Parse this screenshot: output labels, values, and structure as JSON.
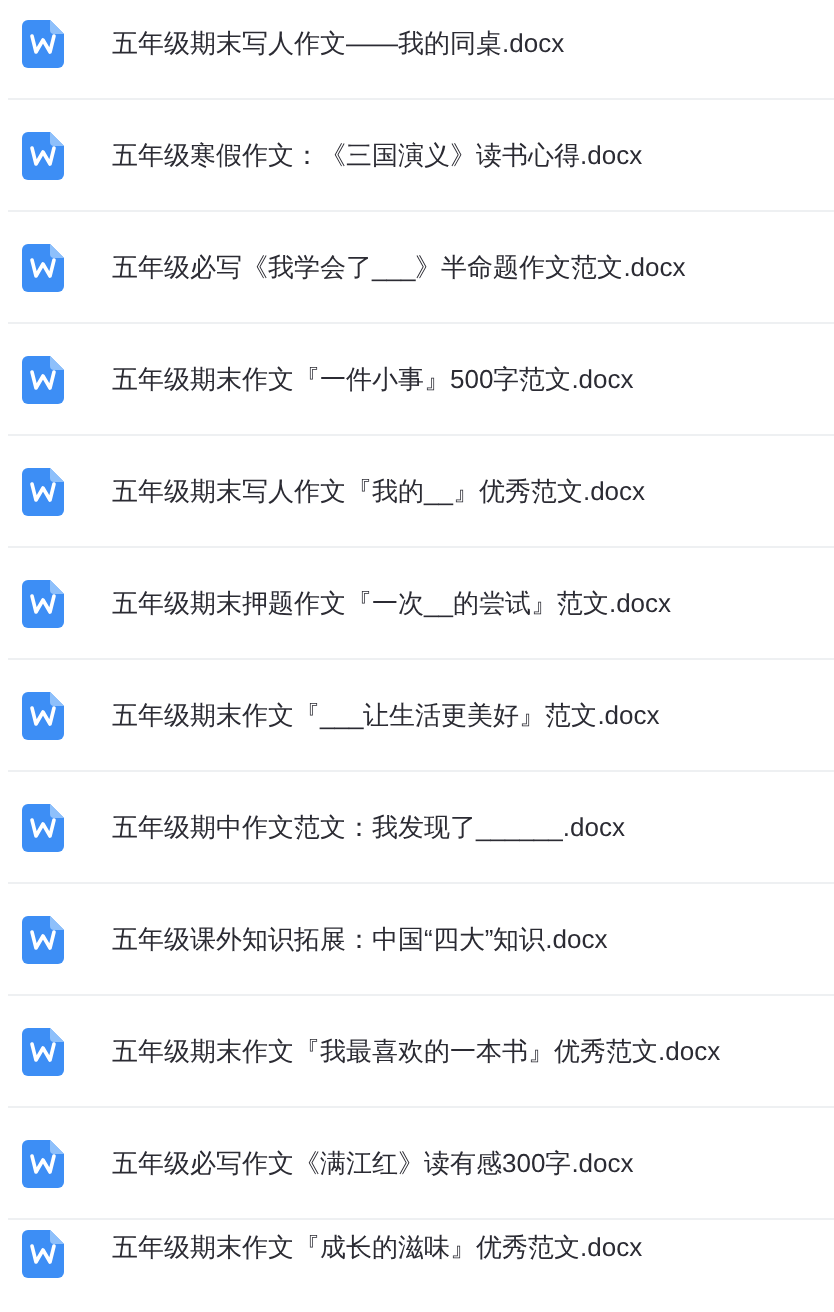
{
  "files": [
    {
      "kind": "word",
      "name": "五年级期末写人作文——我的同桌.docx"
    },
    {
      "kind": "word",
      "name": "五年级寒假作文：《三国演义》读书心得.docx"
    },
    {
      "kind": "word",
      "name": "五年级必写《我学会了___》半命题作文范文.docx"
    },
    {
      "kind": "word",
      "name": "五年级期末作文『一件小事』500字范文.docx"
    },
    {
      "kind": "word",
      "name": "五年级期末写人作文『我的__』优秀范文.docx"
    },
    {
      "kind": "word",
      "name": "五年级期末押题作文『一次__的尝试』范文.docx"
    },
    {
      "kind": "word",
      "name": "五年级期末作文『___让生活更美好』范文.docx"
    },
    {
      "kind": "word",
      "name": "五年级期中作文范文：我发现了______.docx"
    },
    {
      "kind": "word",
      "name": "五年级课外知识拓展：中国“四大”知识.docx"
    },
    {
      "kind": "word",
      "name": "五年级期末作文『我最喜欢的一本书』优秀范文.docx"
    },
    {
      "kind": "word",
      "name": "五年级必写作文《满江红》读有感300字.docx"
    },
    {
      "kind": "word",
      "name": "五年级期末作文『成长的滋味』优秀范文.docx"
    }
  ]
}
